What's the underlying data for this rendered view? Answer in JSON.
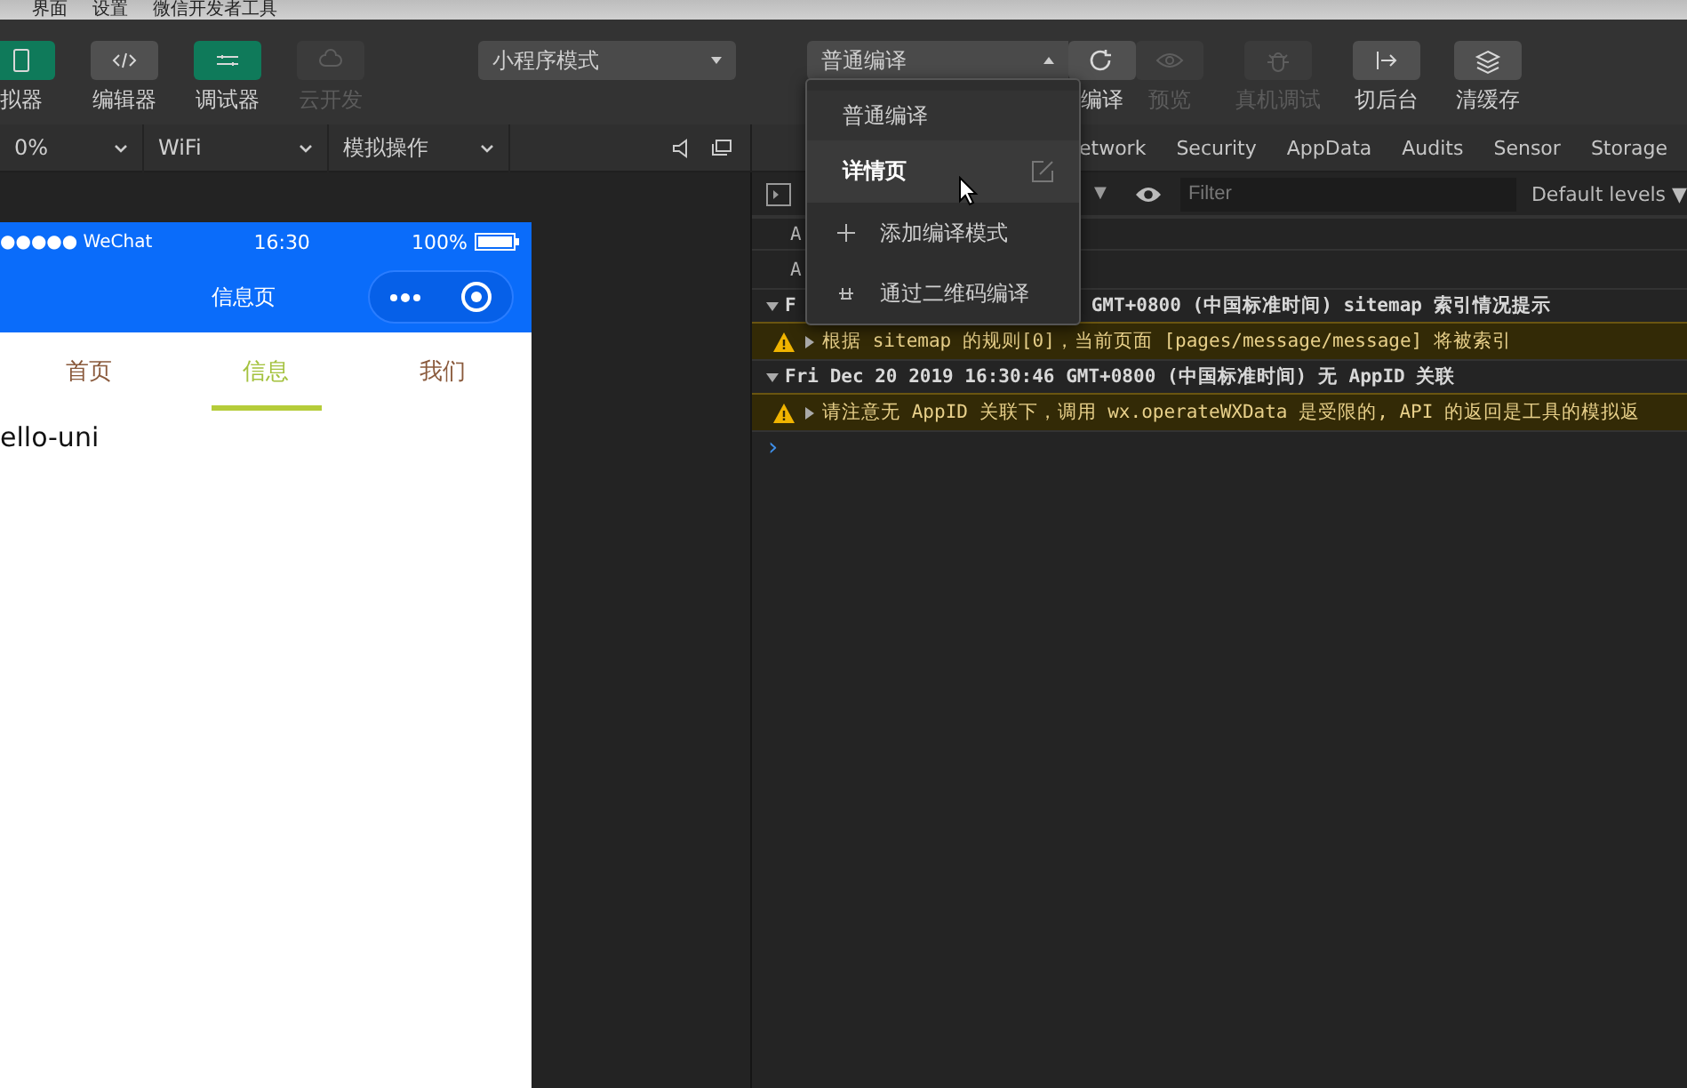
{
  "menubar": [
    "界面",
    "设置",
    "微信开发者工具"
  ],
  "toolbar": {
    "left": [
      {
        "label": "拟器",
        "kind": "green"
      },
      {
        "label": "编辑器",
        "kind": "gray"
      },
      {
        "label": "调试器",
        "kind": "green"
      },
      {
        "label": "云开发",
        "kind": "disabled"
      }
    ],
    "mode_select": "小程序模式",
    "compile_select": "普通编译",
    "right": [
      {
        "label": "编译",
        "disabled": false
      },
      {
        "label": "预览",
        "disabled": true
      },
      {
        "label": "真机调试",
        "disabled": true
      },
      {
        "label": "切后台",
        "disabled": false
      },
      {
        "label": "清缓存",
        "disabled": false
      }
    ]
  },
  "simulator": {
    "zoom": "0%",
    "network": "WiFi",
    "operation": "模拟操作",
    "phone": {
      "carrier": "●●●●● WeChat",
      "time": "16:30",
      "battery": "100%",
      "title": "信息页",
      "tabs": [
        {
          "label": "首页",
          "selected": false
        },
        {
          "label": "信息",
          "selected": true
        },
        {
          "label": "我们",
          "selected": false
        }
      ],
      "content": "ello-uni"
    }
  },
  "compile_menu": [
    {
      "kind": "plain",
      "label": "普通编译",
      "hovered": false
    },
    {
      "kind": "custom",
      "label": "详情页",
      "hovered": true
    },
    {
      "kind": "add",
      "label": "添加编译模式",
      "hovered": false
    },
    {
      "kind": "qr",
      "label": "通过二维码编译",
      "hovered": false
    }
  ],
  "devtools": {
    "tabs": [
      "etwork",
      "Security",
      "AppData",
      "Audits",
      "Sensor",
      "Storage"
    ],
    "level_caret": "▼",
    "filter": {
      "placeholder": "Filter"
    },
    "levels": "Default levels ▼",
    "console": [
      {
        "kind": "info",
        "text": "A"
      },
      {
        "kind": "info",
        "text": "A"
      },
      {
        "kind": "group",
        "lead": "F",
        "text": "GMT+0800 (中国标准时间) sitemap 索引情况提示"
      },
      {
        "kind": "warning",
        "text": "根据 sitemap 的规则[0]，当前页面 [pages/message/message] 将被索引"
      },
      {
        "kind": "group",
        "lead": "Fri Dec 20 2019 16:30:46 GMT+0800 (中国标准时间) 无 AppID 关联"
      },
      {
        "kind": "warning",
        "text": "请注意无 AppID 关联下，调用 wx.operateWXData 是受限的, API 的返回是工具的模拟返"
      },
      {
        "kind": "prompt",
        "text": "›"
      }
    ]
  }
}
